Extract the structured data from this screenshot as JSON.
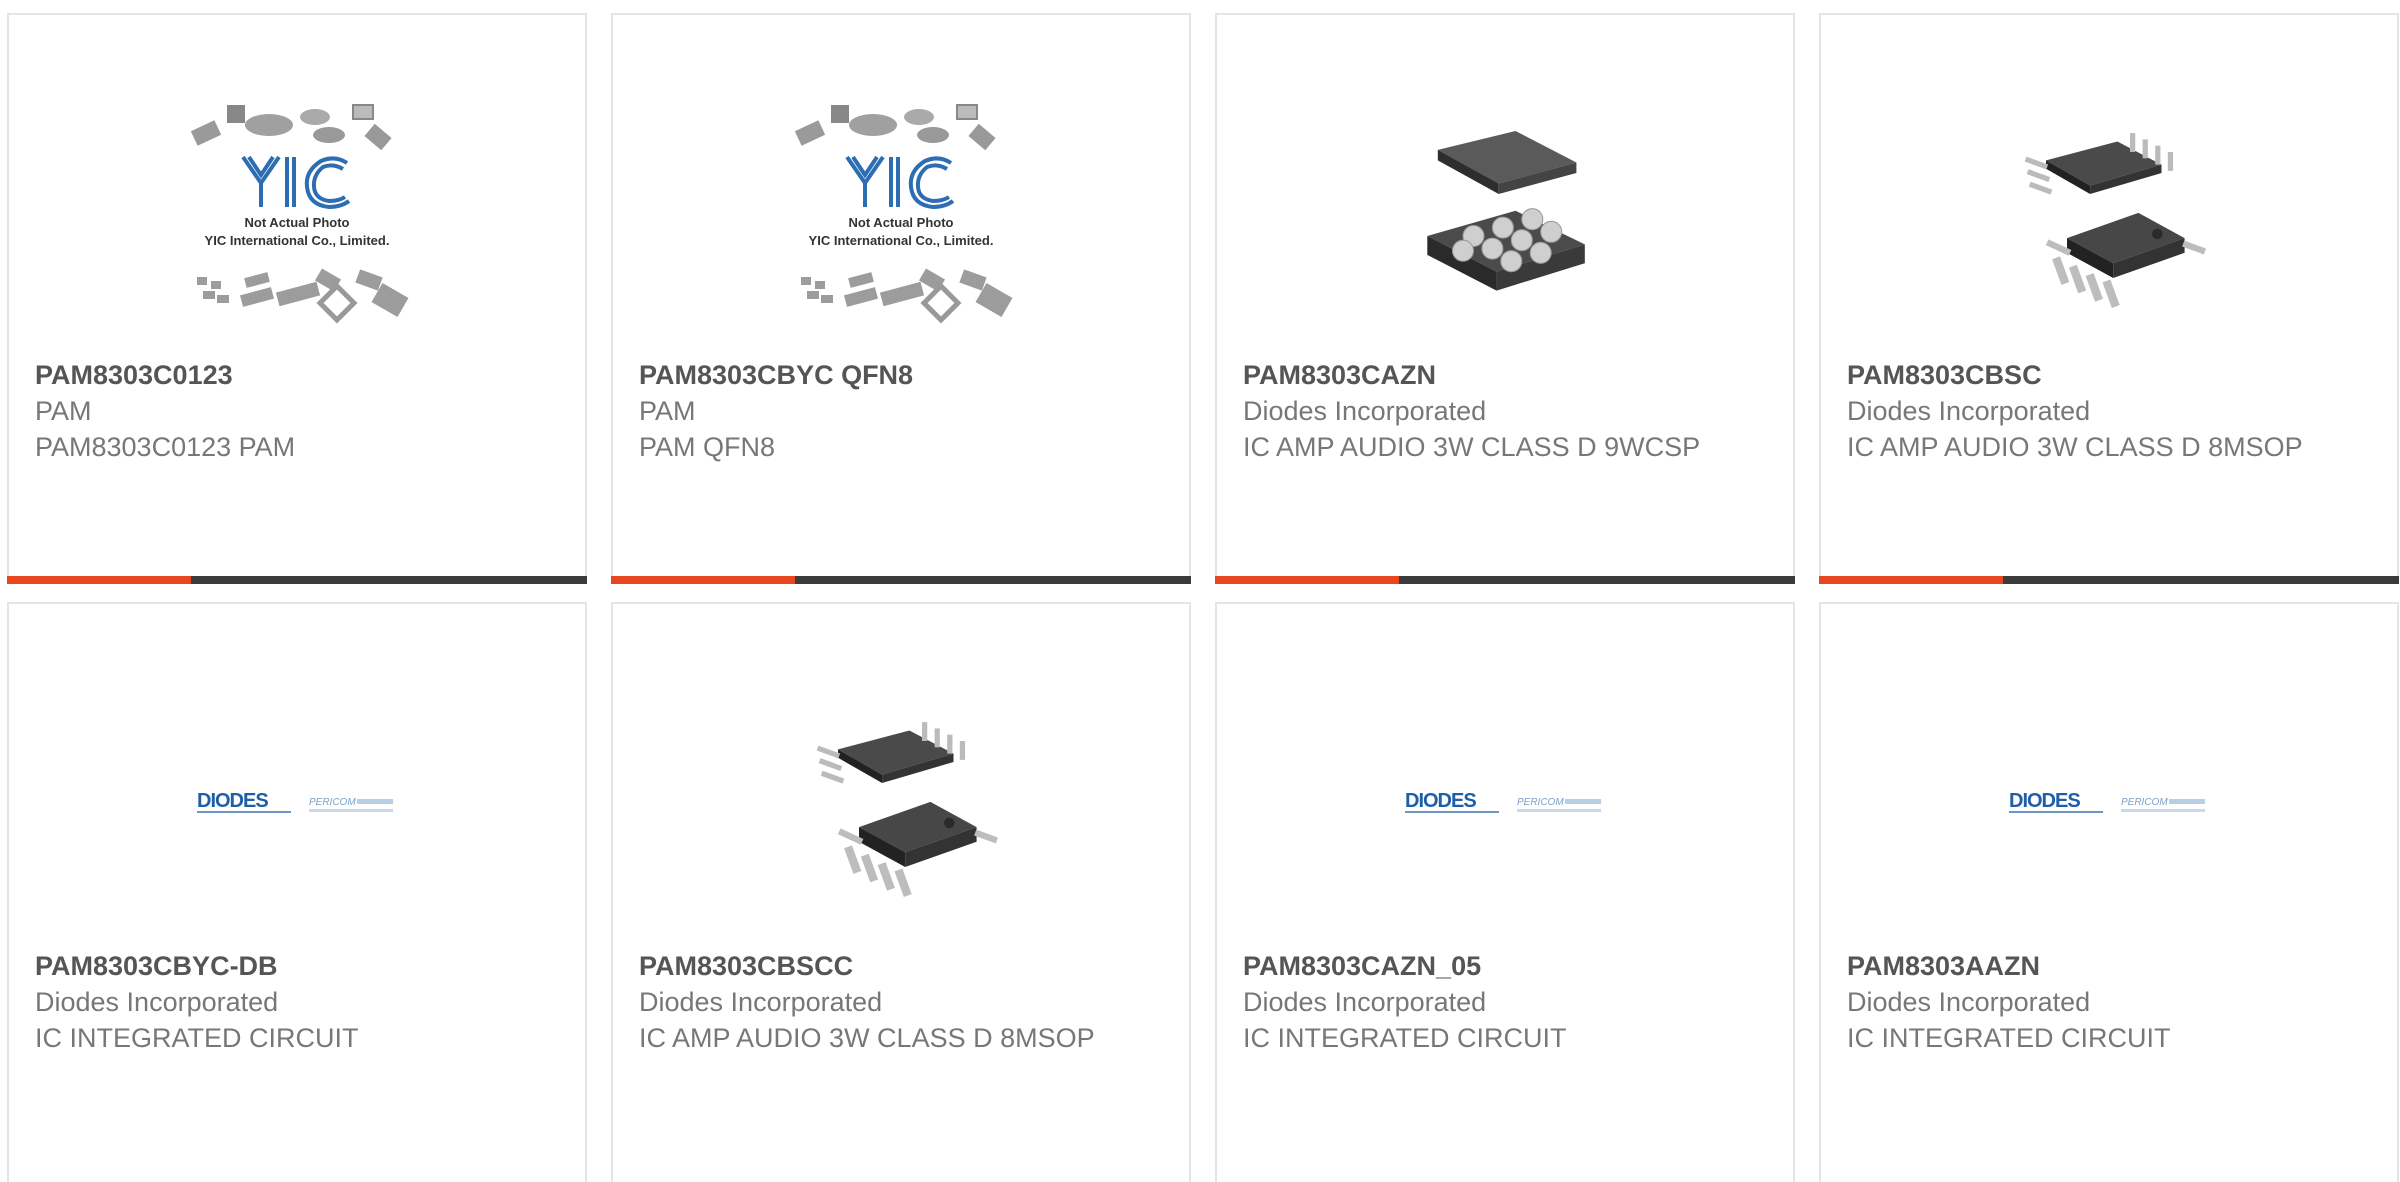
{
  "colors": {
    "accent": "#e8461f",
    "bar": "#3b3b3b",
    "border": "#e5e5e5",
    "title": "#555555",
    "text": "#777777",
    "yic_blue": "#2c6db3",
    "diodes_blue": "#1f5fa8"
  },
  "products": [
    {
      "part": "PAM8303C0123",
      "manufacturer": "PAM",
      "description": "PAM8303C0123 PAM",
      "image": "yic-placeholder",
      "image_caption_1": "Not Actual Photo",
      "image_caption_2": "YIC International Co., Limited."
    },
    {
      "part": "PAM8303CBYC QFN8",
      "manufacturer": "PAM",
      "description": "PAM QFN8",
      "image": "yic-placeholder",
      "image_caption_1": "Not Actual Photo",
      "image_caption_2": "YIC International Co., Limited."
    },
    {
      "part": "PAM8303CAZN",
      "manufacturer": "Diodes Incorporated",
      "description": "IC AMP AUDIO 3W CLASS D 9WCSP",
      "image": "wcsp-chip"
    },
    {
      "part": "PAM8303CBSC",
      "manufacturer": "Diodes Incorporated",
      "description": "IC AMP AUDIO 3W CLASS D 8MSOP",
      "image": "msop-chip"
    },
    {
      "part": "PAM8303CBYC-DB",
      "manufacturer": "Diodes Incorporated",
      "description": "IC INTEGRATED CIRCUIT",
      "image": "diodes-logo"
    },
    {
      "part": "PAM8303CBSCC",
      "manufacturer": "Diodes Incorporated",
      "description": "IC AMP AUDIO 3W CLASS D 8MSOP",
      "image": "msop-chip"
    },
    {
      "part": "PAM8303CAZN_05",
      "manufacturer": "Diodes Incorporated",
      "description": "IC INTEGRATED CIRCUIT",
      "image": "diodes-logo"
    },
    {
      "part": "PAM8303AAZN",
      "manufacturer": "Diodes Incorporated",
      "description": "IC INTEGRATED CIRCUIT",
      "image": "diodes-logo"
    }
  ]
}
